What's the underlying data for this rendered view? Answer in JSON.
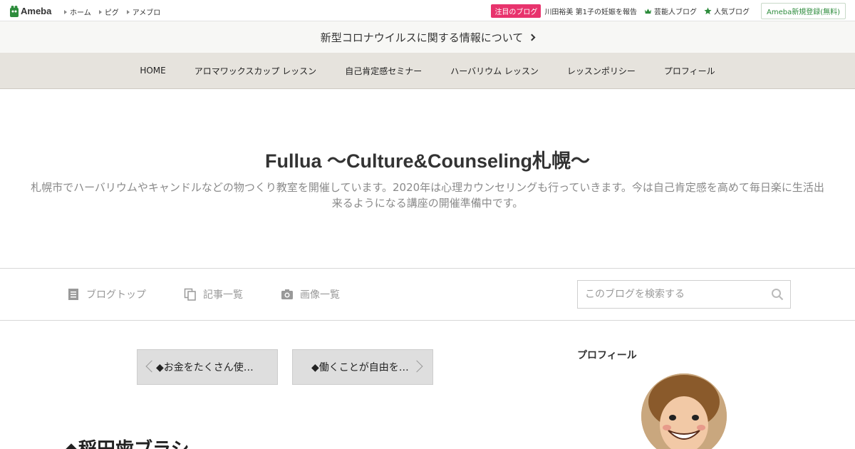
{
  "topbar": {
    "logo_text": "Ameba",
    "nav": [
      "ホーム",
      "ピグ",
      "アメブロ"
    ],
    "featured_badge": "注目のブログ",
    "featured_text": "川田裕美 第1子の妊娠を報告",
    "celebrity_link": "芸能人ブログ",
    "popular_link": "人気ブログ",
    "register_button": "Ameba新規登録(無料)",
    "colors": {
      "badge": "#e8336d",
      "register": "#2d8c3c",
      "icon_green": "#2d8c3c"
    }
  },
  "notice": {
    "text": "新型コロナウイルスに関する情報について"
  },
  "blognav": {
    "items": [
      "HOME",
      "アロマワックスカップ レッスン",
      "自己肯定感セミナー",
      "ハーバリウム レッスン",
      "レッスンポリシー",
      "プロフィール"
    ]
  },
  "header": {
    "title": "Fullua ～Culture&Counseling札幌～",
    "description": "札幌市でハーバリウムやキャンドルなどの物つくり教室を開催しています。2020年は心理カウンセリングも行っていきます。今は自己肯定感を高めて毎日楽に生活出来るようになる講座の開催準備中です。"
  },
  "tools": {
    "blog_top": "ブログトップ",
    "entry_list": "記事一覧",
    "image_list": "画像一覧",
    "search_placeholder": "このブログを検索する"
  },
  "pager": {
    "prev": "◆お金をたくさん使…",
    "next": "◆働くことが自由を…"
  },
  "entry": {
    "title": "◆稲田歯ブラシ"
  },
  "sidebar": {
    "profile_heading": "プロフィール"
  }
}
